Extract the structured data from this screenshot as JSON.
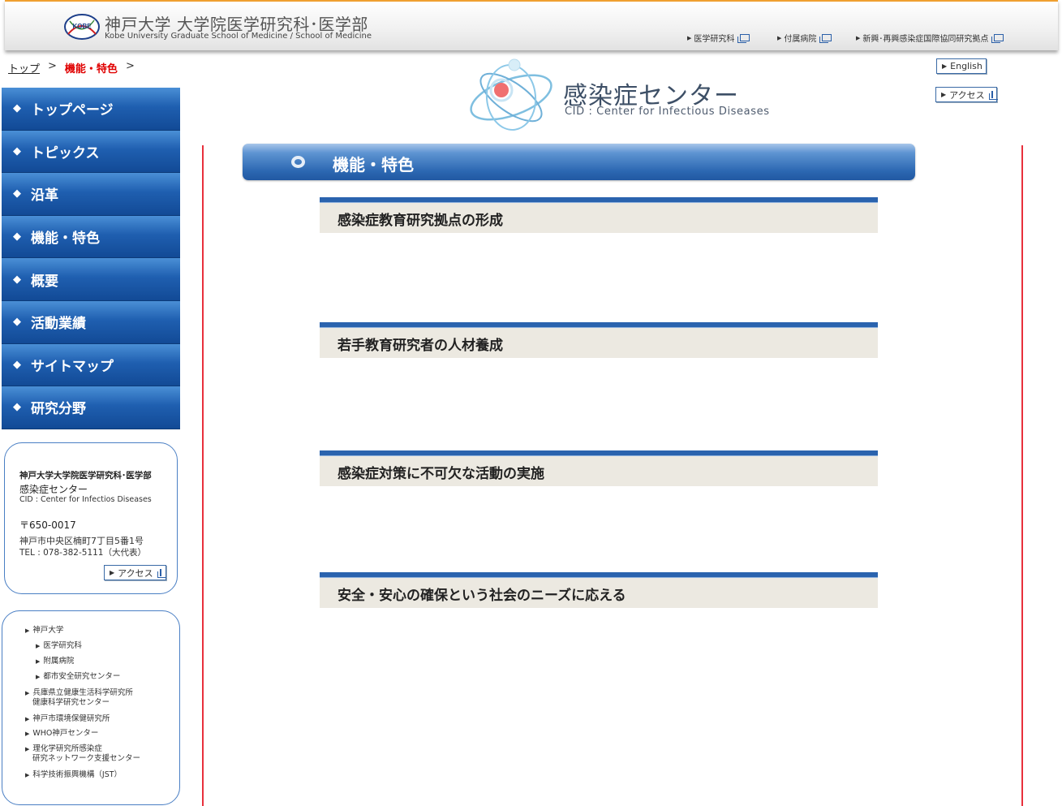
{
  "header": {
    "logo_text": "KOBE",
    "title_ja": "神戸大学 大学院医学研究科･医学部",
    "title_en": "Kobe University Graduate School of Medicine / School of Medicine",
    "links": [
      {
        "label": "医学研究科"
      },
      {
        "label": "付属病院"
      },
      {
        "label": "新興･再興感染症国際協同研究拠点"
      }
    ]
  },
  "breadcrumb": {
    "top": "トップ",
    "sep": ">",
    "current": "機能・特色"
  },
  "site_logo": {
    "title_ja": "感染症センター",
    "title_en": "CID : Center for Infectious Diseases"
  },
  "top_buttons": {
    "english": "English",
    "access": "アクセス"
  },
  "nav": {
    "bullet": "◆",
    "items": [
      {
        "label": "トップページ"
      },
      {
        "label": "トピックス"
      },
      {
        "label": "沿革"
      },
      {
        "label": "機能・特色"
      },
      {
        "label": "概要"
      },
      {
        "label": "活動業績"
      },
      {
        "label": "サイトマップ"
      },
      {
        "label": "研究分野"
      }
    ]
  },
  "address": {
    "org": "神戸大学大学院医学研究科･医学部",
    "center": "感染症センター",
    "center_en": "CID : Center for Infectios Diseases",
    "postal": "〒650-0017",
    "street": "神戸市中央区楠町7丁目5番1号",
    "tel": "TEL : 078-382-5111（大代表）",
    "access": "アクセス"
  },
  "links": [
    {
      "label": "神戸大学"
    },
    {
      "label": "医学研究科"
    },
    {
      "label": "附属病院"
    },
    {
      "label": "都市安全研究センター"
    },
    {
      "label": "兵庫県立健康生活科学研究所"
    },
    {
      "label": "健康科学研究センター"
    },
    {
      "label": "神戸市環境保健研究所"
    },
    {
      "label": "WHO神戸センター"
    },
    {
      "label": "理化学研究所感染症"
    },
    {
      "label": "研究ネットワーク支援センター"
    },
    {
      "label": "科学技術振興機構（JST）"
    }
  ],
  "main": {
    "heading": "機能・特色",
    "features": [
      {
        "title": "感染症教育研究拠点の形成"
      },
      {
        "title": "若手教育研究者の人材養成"
      },
      {
        "title": "感染症対策に不可欠な活動の実施"
      },
      {
        "title": "安全・安心の確保という社会のニーズに応える"
      }
    ]
  },
  "colors": {
    "nav_blue": "#1f5fb0",
    "accent_red": "#e00000",
    "border_red": "#e8303c",
    "feature_bg": "#ece9e1"
  }
}
